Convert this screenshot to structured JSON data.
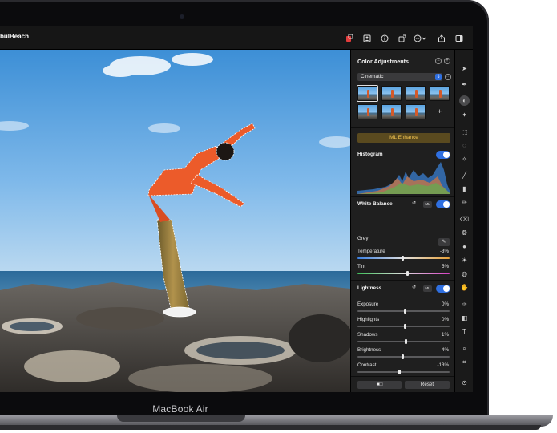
{
  "window": {
    "title": "bulBeach"
  },
  "device": {
    "label": "MacBook Air"
  },
  "panel": {
    "title": "Color Adjustments",
    "preset": "Cinematic",
    "ml_enhance": "ML Enhance",
    "histogram": {
      "label": "Histogram",
      "enabled": true
    },
    "white_balance": {
      "label": "White Balance",
      "ml": "ML",
      "enabled": true,
      "grey_label": "Grey",
      "rows": [
        {
          "label": "Temperature",
          "value": "-3%",
          "position": 0.48
        },
        {
          "label": "Tint",
          "value": "5%",
          "position": 0.53
        }
      ]
    },
    "lightness": {
      "label": "Lightness",
      "ml": "ML",
      "enabled": true,
      "rows": [
        {
          "label": "Exposure",
          "value": "0%",
          "position": 0.5
        },
        {
          "label": "Highlights",
          "value": "0%",
          "position": 0.5
        },
        {
          "label": "Shadows",
          "value": "1%",
          "position": 0.51
        },
        {
          "label": "Brightness",
          "value": "-4%",
          "position": 0.48
        },
        {
          "label": "Contrast",
          "value": "-13%",
          "position": 0.44
        }
      ]
    },
    "footer": {
      "reset": "Reset",
      "compare_icon": "split-compare-icon"
    }
  },
  "colors": {
    "accent": "#2f6fe0",
    "ml_gold": "#f3c451"
  }
}
